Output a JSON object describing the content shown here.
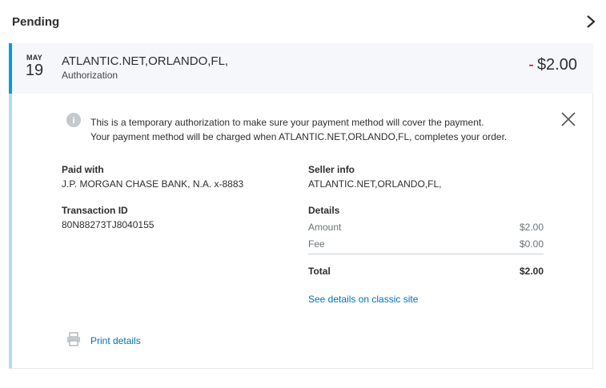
{
  "section": {
    "title": "Pending"
  },
  "transaction": {
    "month": "MAY",
    "day": "19",
    "merchant": "ATLANTIC.NET,ORLANDO,FL,",
    "type": "Authorization",
    "amount_sign": "-",
    "amount": "$2.00"
  },
  "details": {
    "notice_line1": "This is a temporary authorization to make sure your payment method will cover the payment.",
    "notice_line2": "Your payment method will be charged when ATLANTIC.NET,ORLANDO,FL, completes your order.",
    "paid_with_label": "Paid with",
    "paid_with_value": "J.P. MORGAN CHASE BANK, N.A. x-8883",
    "transaction_id_label": "Transaction ID",
    "transaction_id_value": "80N88273TJ8040155",
    "seller_info_label": "Seller info",
    "seller_info_value": "ATLANTIC.NET,ORLANDO,FL,",
    "details_label": "Details",
    "rows": [
      {
        "label": "Amount",
        "value": "$2.00"
      },
      {
        "label": "Fee",
        "value": "$0.00"
      }
    ],
    "total_label": "Total",
    "total_value": "$2.00",
    "classic_link": "See details on classic site",
    "print_link": "Print details"
  },
  "colors": {
    "accent": "#009cde",
    "link": "#0070ba",
    "negative": "#d0021b"
  },
  "icons": [
    "chevron-right-icon",
    "info-icon",
    "close-icon",
    "printer-icon"
  ]
}
